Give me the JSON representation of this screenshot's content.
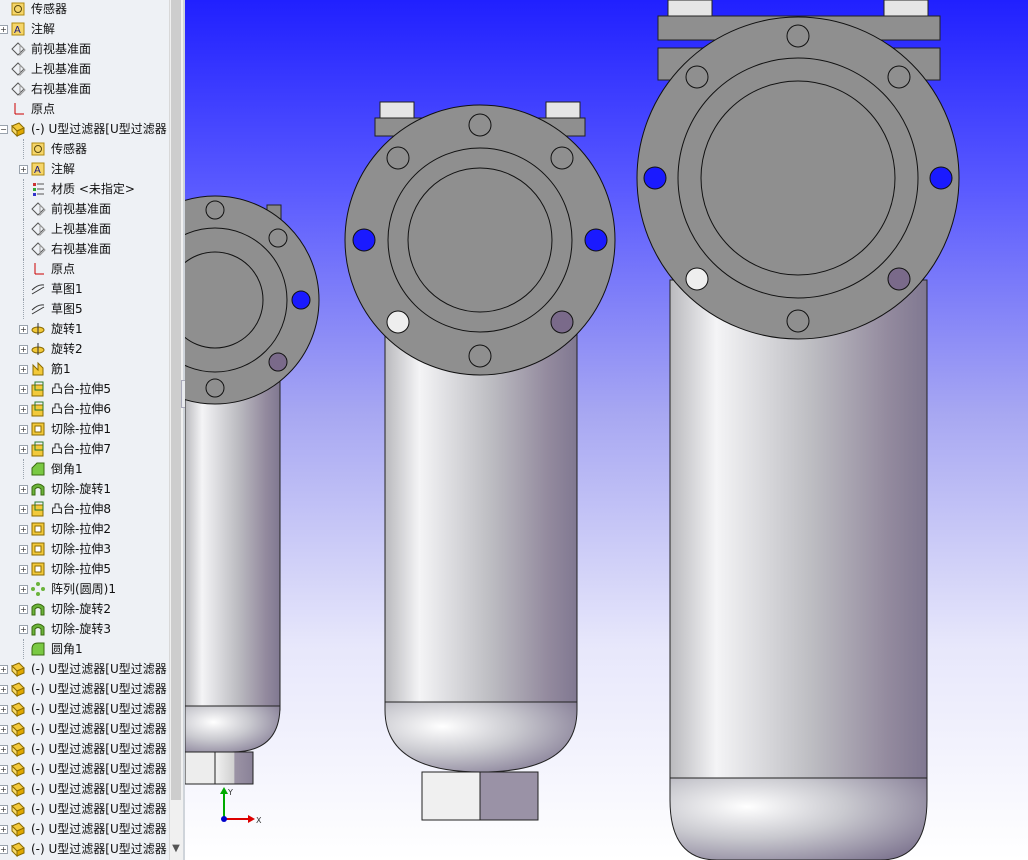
{
  "feature_tree": {
    "items": [
      {
        "label": "传感器",
        "level": 0,
        "expandable": false,
        "icon": "sensor-icon"
      },
      {
        "label": "注解",
        "level": 0,
        "expandable": true,
        "icon": "annotation-icon"
      },
      {
        "label": "前视基准面",
        "level": 0,
        "expandable": false,
        "icon": "plane-icon"
      },
      {
        "label": "上视基准面",
        "level": 0,
        "expandable": false,
        "icon": "plane-icon"
      },
      {
        "label": "右视基准面",
        "level": 0,
        "expandable": false,
        "icon": "plane-icon"
      },
      {
        "label": "原点",
        "level": 0,
        "expandable": false,
        "icon": "origin-icon"
      },
      {
        "label": "(-) U型过滤器[U型过滤器",
        "level": 0,
        "expandable": true,
        "expanded": true,
        "icon": "part-icon"
      },
      {
        "label": "传感器",
        "level": 1,
        "expandable": false,
        "icon": "sensor-icon"
      },
      {
        "label": "注解",
        "level": 1,
        "expandable": true,
        "icon": "annotation-icon"
      },
      {
        "label": "材质 <未指定>",
        "level": 1,
        "expandable": false,
        "icon": "material-icon"
      },
      {
        "label": "前视基准面",
        "level": 1,
        "expandable": false,
        "icon": "plane-icon"
      },
      {
        "label": "上视基准面",
        "level": 1,
        "expandable": false,
        "icon": "plane-icon"
      },
      {
        "label": "右视基准面",
        "level": 1,
        "expandable": false,
        "icon": "plane-icon"
      },
      {
        "label": "原点",
        "level": 1,
        "expandable": false,
        "icon": "origin-icon"
      },
      {
        "label": "草图1",
        "level": 1,
        "expandable": false,
        "icon": "sketch-icon"
      },
      {
        "label": "草图5",
        "level": 1,
        "expandable": false,
        "icon": "sketch-icon"
      },
      {
        "label": "旋转1",
        "level": 1,
        "expandable": true,
        "icon": "revolve-icon"
      },
      {
        "label": "旋转2",
        "level": 1,
        "expandable": true,
        "icon": "revolve-icon"
      },
      {
        "label": "筋1",
        "level": 1,
        "expandable": true,
        "icon": "rib-icon"
      },
      {
        "label": "凸台-拉伸5",
        "level": 1,
        "expandable": true,
        "icon": "boss-extrude-icon"
      },
      {
        "label": "凸台-拉伸6",
        "level": 1,
        "expandable": true,
        "icon": "boss-extrude-icon"
      },
      {
        "label": "切除-拉伸1",
        "level": 1,
        "expandable": true,
        "icon": "cut-extrude-icon"
      },
      {
        "label": "凸台-拉伸7",
        "level": 1,
        "expandable": true,
        "icon": "boss-extrude-icon"
      },
      {
        "label": "倒角1",
        "level": 1,
        "expandable": false,
        "icon": "chamfer-icon"
      },
      {
        "label": "切除-旋转1",
        "level": 1,
        "expandable": true,
        "icon": "cut-revolve-icon"
      },
      {
        "label": "凸台-拉伸8",
        "level": 1,
        "expandable": true,
        "icon": "boss-extrude-icon"
      },
      {
        "label": "切除-拉伸2",
        "level": 1,
        "expandable": true,
        "icon": "cut-extrude-icon"
      },
      {
        "label": "切除-拉伸3",
        "level": 1,
        "expandable": true,
        "icon": "cut-extrude-icon"
      },
      {
        "label": "切除-拉伸5",
        "level": 1,
        "expandable": true,
        "icon": "cut-extrude-icon"
      },
      {
        "label": "阵列(圆周)1",
        "level": 1,
        "expandable": true,
        "icon": "circular-pattern-icon"
      },
      {
        "label": "切除-旋转2",
        "level": 1,
        "expandable": true,
        "icon": "cut-revolve-icon"
      },
      {
        "label": "切除-旋转3",
        "level": 1,
        "expandable": true,
        "icon": "cut-revolve-icon"
      },
      {
        "label": "圆角1",
        "level": 1,
        "expandable": false,
        "icon": "fillet-icon"
      },
      {
        "label": "(-) U型过滤器[U型过滤器",
        "level": 0,
        "expandable": true,
        "icon": "part-icon"
      },
      {
        "label": "(-) U型过滤器[U型过滤器",
        "level": 0,
        "expandable": true,
        "icon": "part-icon"
      },
      {
        "label": "(-) U型过滤器[U型过滤器",
        "level": 0,
        "expandable": true,
        "icon": "part-icon"
      },
      {
        "label": "(-) U型过滤器[U型过滤器",
        "level": 0,
        "expandable": true,
        "icon": "part-icon"
      },
      {
        "label": "(-) U型过滤器[U型过滤器",
        "level": 0,
        "expandable": true,
        "icon": "part-icon"
      },
      {
        "label": "(-) U型过滤器[U型过滤器",
        "level": 0,
        "expandable": true,
        "icon": "part-icon"
      },
      {
        "label": "(-) U型过滤器[U型过滤器",
        "level": 0,
        "expandable": true,
        "icon": "part-icon"
      },
      {
        "label": "(-) U型过滤器[U型过滤器",
        "level": 0,
        "expandable": true,
        "icon": "part-icon"
      },
      {
        "label": "(-) U型过滤器[U型过滤器",
        "level": 0,
        "expandable": true,
        "icon": "part-icon"
      },
      {
        "label": "(-) U型过滤器[U型过滤器",
        "level": 0,
        "expandable": true,
        "icon": "part-icon"
      }
    ]
  },
  "triad": {
    "x_label": "X",
    "y_label": "Y"
  },
  "colors": {
    "viewport_top": "#2020ff",
    "viewport_bottom": "#ffffff",
    "part_gray": "#8f8f8f",
    "hole_blue": "#1a1aff"
  }
}
